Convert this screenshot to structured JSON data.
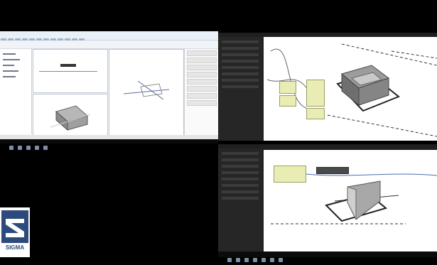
{
  "logo": {
    "text": "SIGMA"
  },
  "colors": {
    "background": "#000000",
    "revit_bg": "#ffffff",
    "revit_ribbon": "#eaf0f7",
    "dynamo_sidebar": "#222222",
    "dynamo_canvas": "#ffffff",
    "node_fill": "#e9edb3",
    "logo_blue": "#2c4a7c"
  },
  "icons": {
    "ribbon": "toolbar-icons",
    "dynamo_nodes": "code-block-nodes",
    "model_3d": "3d-massing-model",
    "taskbar": "taskbar-icons"
  }
}
